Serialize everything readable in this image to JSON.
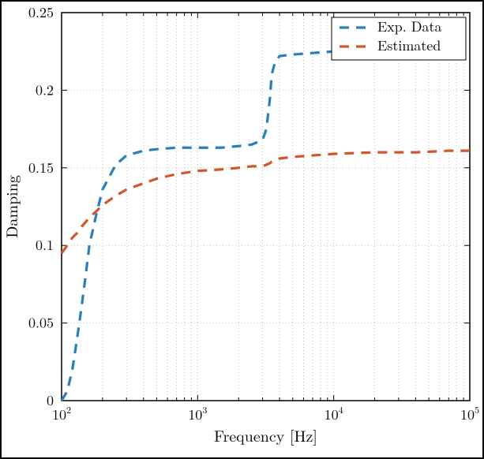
{
  "chart_data": {
    "type": "line",
    "title": "",
    "xlabel": "Frequency [Hz]",
    "ylabel": "Damping",
    "xscale": "log",
    "xlim": [
      100,
      100000
    ],
    "ylim": [
      0,
      0.25
    ],
    "xticks": [
      100,
      1000,
      10000,
      100000
    ],
    "xtick_labels": [
      "10^2",
      "10^3",
      "10^4",
      "10^5"
    ],
    "yticks": [
      0,
      0.05,
      0.1,
      0.15,
      0.2,
      0.25
    ],
    "ytick_labels": [
      "0",
      "0.05",
      "0.1",
      "0.15",
      "0.2",
      "0.25"
    ],
    "legend": {
      "position": "upper right",
      "entries": [
        "Exp. Data",
        "Estimated"
      ]
    },
    "series": [
      {
        "name": "Exp. Data",
        "color": "#2a7fb8",
        "dash": "dashed",
        "x": [
          100,
          110,
          120,
          130,
          140,
          150,
          160,
          180,
          200,
          250,
          300,
          400,
          500,
          700,
          1000,
          1500,
          2000,
          2500,
          3000,
          3200,
          3400,
          3500,
          3700,
          4000,
          5000,
          7000,
          10000,
          20000,
          40000,
          70000,
          100000
        ],
        "y": [
          0.0,
          0.006,
          0.02,
          0.04,
          0.06,
          0.08,
          0.1,
          0.12,
          0.136,
          0.152,
          0.158,
          0.161,
          0.162,
          0.163,
          0.163,
          0.163,
          0.164,
          0.165,
          0.168,
          0.175,
          0.195,
          0.21,
          0.218,
          0.222,
          0.223,
          0.224,
          0.225,
          0.228,
          0.232,
          0.238,
          0.245
        ]
      },
      {
        "name": "Estimated",
        "color": "#d1562b",
        "dash": "dashed",
        "x": [
          100,
          110,
          120,
          130,
          140,
          150,
          160,
          180,
          200,
          250,
          300,
          400,
          500,
          700,
          1000,
          1500,
          2000,
          2500,
          3000,
          3200,
          3400,
          3500,
          3700,
          4000,
          5000,
          7000,
          10000,
          20000,
          40000,
          70000,
          100000
        ],
        "y": [
          0.095,
          0.1,
          0.105,
          0.108,
          0.112,
          0.115,
          0.118,
          0.122,
          0.126,
          0.132,
          0.136,
          0.14,
          0.143,
          0.146,
          0.148,
          0.149,
          0.15,
          0.151,
          0.151,
          0.152,
          0.153,
          0.154,
          0.155,
          0.156,
          0.157,
          0.158,
          0.159,
          0.16,
          0.16,
          0.161,
          0.161
        ]
      }
    ]
  }
}
